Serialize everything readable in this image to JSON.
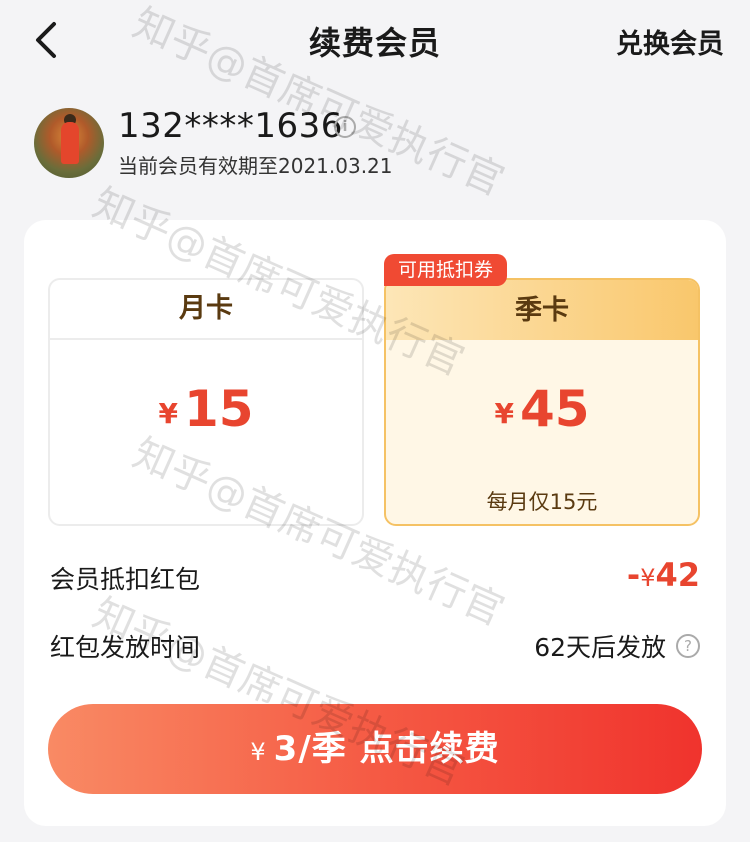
{
  "nav": {
    "title": "续费会员",
    "right_action": "兑换会员"
  },
  "user": {
    "phone": "132****1636",
    "info_glyph": "i",
    "expire_text": "当前会员有效期至2021.03.21"
  },
  "plans": [
    {
      "name": "月卡",
      "currency": "¥",
      "price": "15",
      "note": ""
    },
    {
      "name": "季卡",
      "currency": "¥",
      "price": "45",
      "note": "每月仅15元",
      "tag": "可用抵扣券",
      "selected": true
    }
  ],
  "details": {
    "coupon_label": "会员抵扣红包",
    "coupon_sign": "-",
    "coupon_currency": "¥",
    "coupon_amount": "42",
    "release_label": "红包发放时间",
    "release_value": "62天后发放",
    "help_glyph": "?"
  },
  "cta": {
    "currency": "¥",
    "label": "3/季  点击续费"
  },
  "watermark": "知乎@首席可爱执行官",
  "colors": {
    "accent_red": "#e8452f",
    "gold": "#f5c264",
    "tag_red": "#f04a33"
  },
  "icons": [
    "back-arrow-icon",
    "info-icon",
    "help-icon",
    "avatar"
  ]
}
